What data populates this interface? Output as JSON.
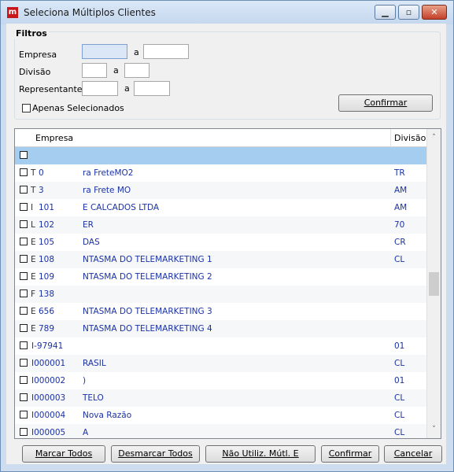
{
  "window": {
    "title": "Seleciona Múltiplos Clientes",
    "icon": "app-logo-icon"
  },
  "filters": {
    "legend": "Filtros",
    "empresa_label": "Empresa",
    "empresa_from": "",
    "a1": "a",
    "empresa_to": "",
    "divisao_label": "Divisão",
    "divisao_from": "",
    "a2": "a",
    "divisao_to": "",
    "representante_label": "Representante",
    "rep_from": "",
    "a3": "a",
    "rep_to": "",
    "apenas_label": "Apenas Selecionados",
    "confirm_label": "Confirmar"
  },
  "grid": {
    "col_empresa": "Empresa",
    "col_divisao": "Divisão",
    "rows": [
      {
        "prefix": "",
        "code": "",
        "name": "",
        "div": ""
      },
      {
        "prefix": "T",
        "code": "0",
        "name": "ra FreteMO2",
        "div": "TR"
      },
      {
        "prefix": "T",
        "code": "3",
        "name": "ra Frete MO",
        "div": "AM"
      },
      {
        "prefix": "I",
        "code": "101",
        "name": "E CALCADOS LTDA",
        "div": "AM"
      },
      {
        "prefix": "L",
        "code": "102",
        "name": "ER",
        "div": "70"
      },
      {
        "prefix": "E",
        "code": "105",
        "name": "DAS",
        "div": "CR"
      },
      {
        "prefix": "E",
        "code": "108",
        "name": "NTASMA DO TELEMARKETING 1",
        "div": "CL"
      },
      {
        "prefix": "E",
        "code": "109",
        "name": "NTASMA DO TELEMARKETING 2",
        "div": ""
      },
      {
        "prefix": "F",
        "code": "138",
        "name": "",
        "div": ""
      },
      {
        "prefix": "E",
        "code": "656",
        "name": "NTASMA DO TELEMARKETING 3",
        "div": ""
      },
      {
        "prefix": "E",
        "code": "789",
        "name": "NTASMA DO TELEMARKETING 4",
        "div": ""
      },
      {
        "prefix": "",
        "code": "I-97941",
        "name": "",
        "div": "01"
      },
      {
        "prefix": "",
        "code": "I000001",
        "name": "RASIL",
        "div": "CL"
      },
      {
        "prefix": "",
        "code": "I000002",
        "name": ")",
        "div": "01"
      },
      {
        "prefix": "",
        "code": "I000003",
        "name": "TELO",
        "div": "CL"
      },
      {
        "prefix": "",
        "code": "I000004",
        "name": "Nova Razão",
        "div": "CL"
      },
      {
        "prefix": "",
        "code": "I000005",
        "name": "A",
        "div": "CL"
      }
    ]
  },
  "buttons": {
    "marcar": "Marcar Todos",
    "desmarcar": "Desmarcar Todos",
    "nao_utiliz": "Não Utiliz. Mútl. E",
    "confirmar": "Confirmar",
    "cancelar": "Cancelar"
  }
}
